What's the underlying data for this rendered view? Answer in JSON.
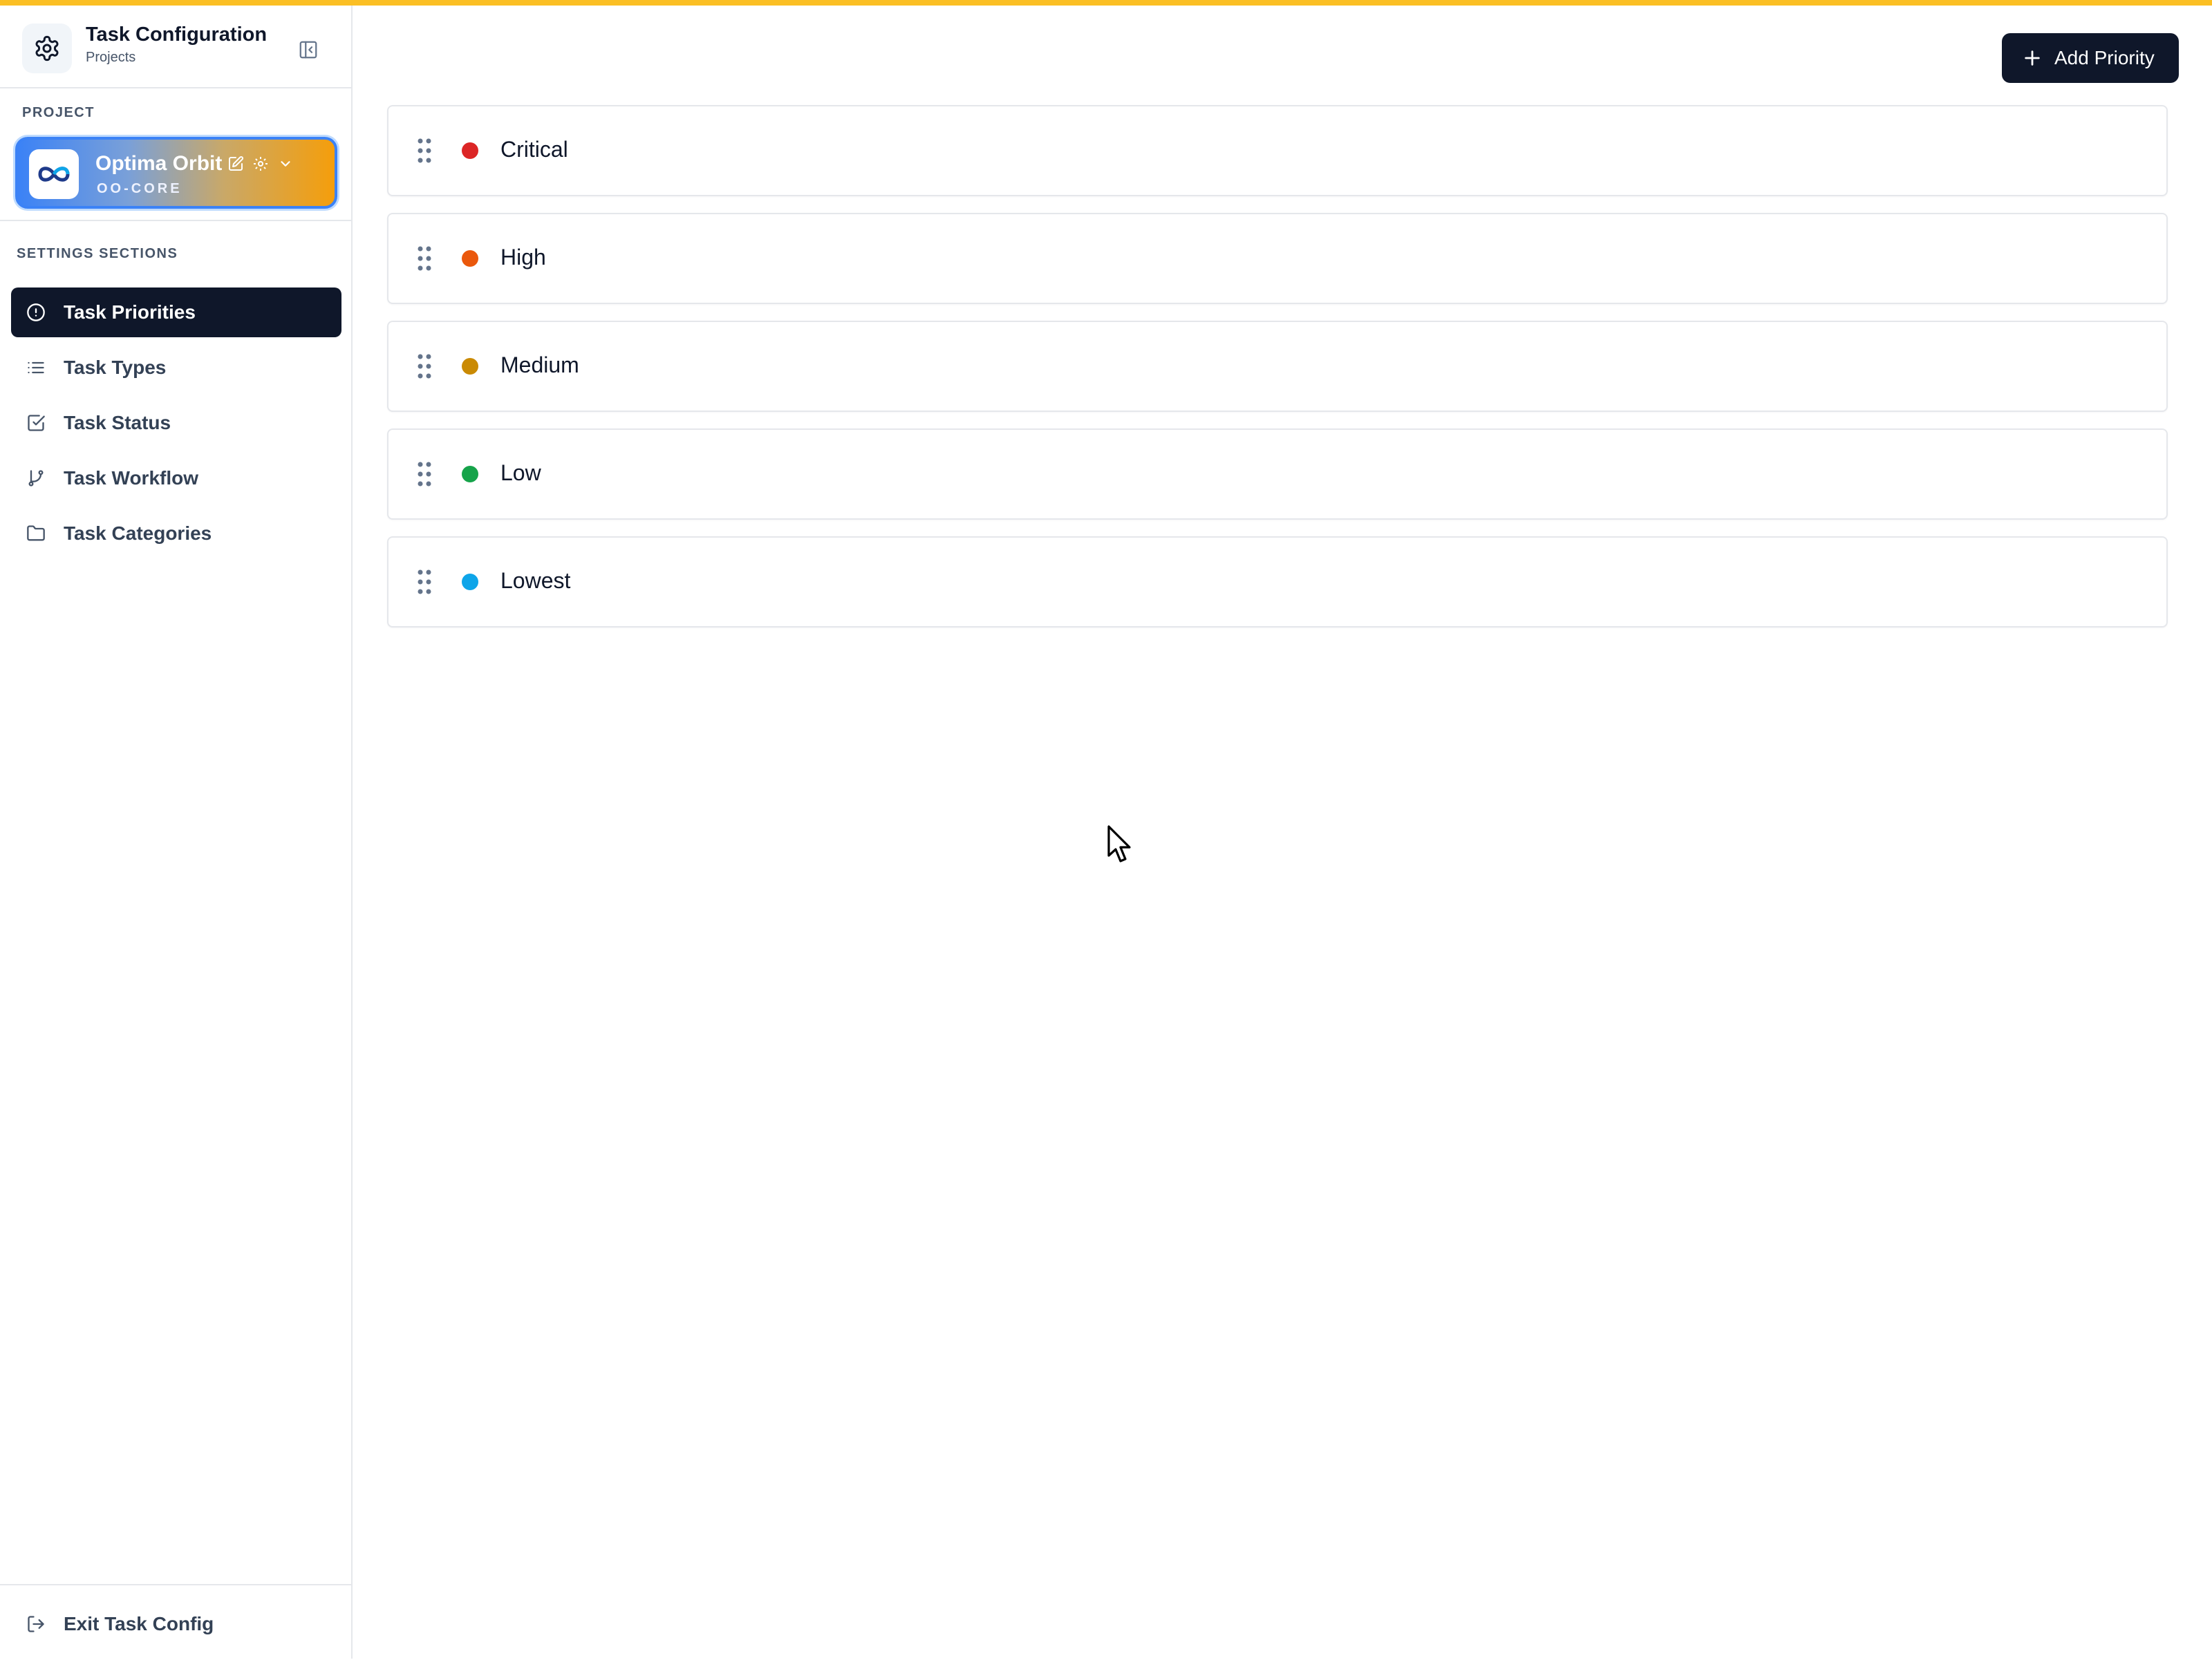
{
  "app": {
    "title": "Task Configuration",
    "subtitle": "Projects"
  },
  "project": {
    "section_label": "PROJECT",
    "name": "Optima Orbit",
    "code": "OO-CORE"
  },
  "sidebar": {
    "section_label": "SETTINGS SECTIONS",
    "items": [
      {
        "label": "Task Priorities",
        "icon": "alert-circle-icon",
        "active": true
      },
      {
        "label": "Task Types",
        "icon": "list-icon",
        "active": false
      },
      {
        "label": "Task Status",
        "icon": "check-square-icon",
        "active": false
      },
      {
        "label": "Task Workflow",
        "icon": "git-branch-icon",
        "active": false
      },
      {
        "label": "Task Categories",
        "icon": "folder-icon",
        "active": false
      }
    ],
    "exit_label": "Exit Task Config"
  },
  "toolbar": {
    "add_label": "Add Priority"
  },
  "priorities": [
    {
      "label": "Critical",
      "color": "#dc2626"
    },
    {
      "label": "High",
      "color": "#ea580c"
    },
    {
      "label": "Medium",
      "color": "#ca8a04"
    },
    {
      "label": "Low",
      "color": "#16a34a"
    },
    {
      "label": "Lowest",
      "color": "#0ea5e9"
    }
  ],
  "colors": {
    "accent_bar": "#fbbf24",
    "active_nav": "#0f172a"
  }
}
